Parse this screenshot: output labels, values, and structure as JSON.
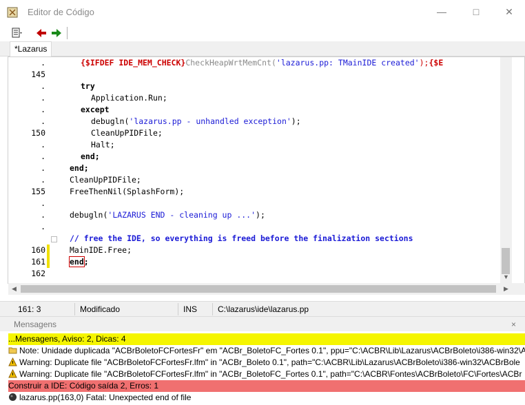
{
  "window": {
    "title": "Editor de Código"
  },
  "tabs": [
    {
      "label": "*Lazarus"
    }
  ],
  "gutter": {
    "line_numbers": [
      ".",
      "145",
      ".",
      ".",
      ".",
      ".",
      "150",
      ".",
      ".",
      ".",
      ".",
      "155",
      ".",
      ".",
      ".",
      "160",
      "161",
      "162"
    ]
  },
  "code": {
    "l0_dir": "{$IFDEF IDE_MEM_CHECK}",
    "l0_call": "CheckHeapWrtMemCnt(",
    "l0_str": "'lazarus.pp: TMainIDE created'",
    "l0_tail": ");",
    "l0_dir2": "{$E",
    "try": "try",
    "app_run": "Application.Run;",
    "except": "except",
    "debugln1_a": "debugln(",
    "debugln1_str": "'lazarus.pp - unhandled exception'",
    "debugln1_b": ");",
    "cleanup1": "CleanUpPIDFile;",
    "halt": "Halt;",
    "end1": "end;",
    "end2": "end;",
    "cleanup2": "CleanUpPIDFile;",
    "freethennil": "FreeThenNil(SplashForm);",
    "debugln2_a": "debugln(",
    "debugln2_str": "'LAZARUS END - cleaning up ...'",
    "debugln2_b": ");",
    "comment": "// free the IDE, so everything is freed before the finalization sections",
    "mainide_free": "MainIDE.Free;",
    "end_kw": "end",
    "end_dot": ";"
  },
  "status": {
    "position": "161:  3",
    "modified": "Modificado",
    "mode": "INS",
    "file": "C:\\lazarus\\ide\\lazarus.pp"
  },
  "messages": {
    "title": "Mensagens",
    "close": "×",
    "rows": [
      {
        "text": "...Mensagens, Aviso: 2, Dicas: 4",
        "kind": "summary"
      },
      {
        "text": "Note: Unidade duplicada \"ACBrBoletoFCFortesFr\" em \"ACBr_BoletoFC_Fortes 0.1\", ppu=\"C:\\ACBR\\Lib\\Lazarus\\ACBrBoleto\\i386-win32\\A",
        "kind": "note"
      },
      {
        "text": "Warning: Duplicate file \"ACBrBoletoFCFortesFr.lfm\" in \"ACBr_Boleto 0.1\", path=\"C:\\ACBR\\Lib\\Lazarus\\ACBrBoleto\\i386-win32\\ACBrBole",
        "kind": "warning"
      },
      {
        "text": "Warning: Duplicate file \"ACBrBoletoFCFortesFr.lfm\" in \"ACBr_BoletoFC_Fortes 0.1\", path=\"C:\\ACBR\\Fontes\\ACBrBoleto\\FC\\Fortes\\ACBr",
        "kind": "warning"
      },
      {
        "text": "Construir a IDE: Código saída 2, Erros: 1",
        "kind": "error-summary"
      },
      {
        "text": "lazarus.pp(163,0) Fatal: Unexpected end of file",
        "kind": "fatal"
      }
    ]
  },
  "colors": {
    "summary_row": "#f5f500",
    "error_row": "#f07070",
    "string": "#1a1ad6",
    "directive": "#cc0000"
  }
}
